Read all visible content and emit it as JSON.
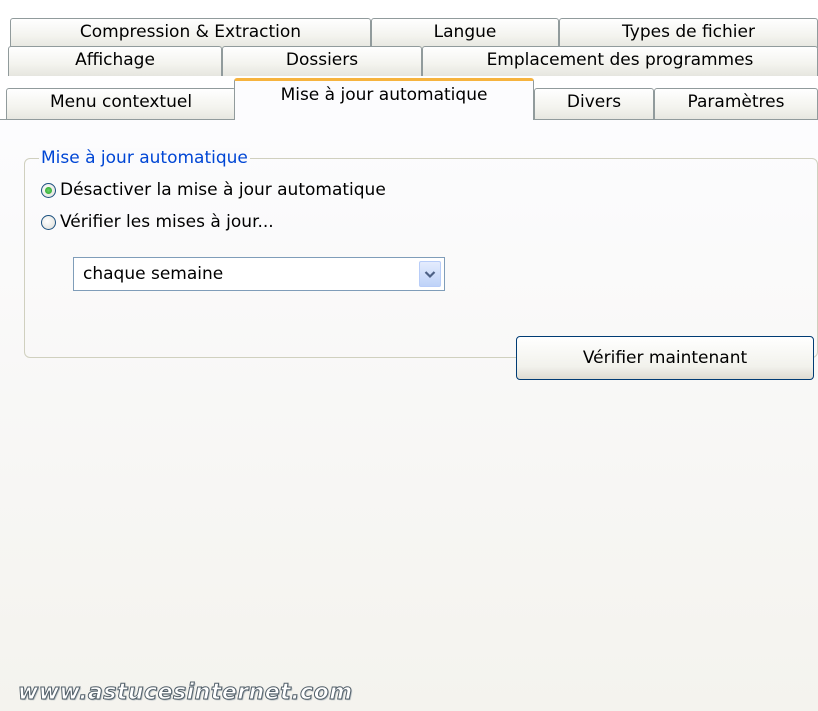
{
  "tabs": {
    "row1": [
      "Compression & Extraction",
      "Langue",
      "Types de fichier"
    ],
    "row2": [
      "Affichage",
      "Dossiers",
      "Emplacement des programmes"
    ],
    "row3": [
      "Menu contextuel",
      "Mise à jour automatique",
      "Divers",
      "Paramètres"
    ],
    "active": "Mise à jour automatique"
  },
  "update_group": {
    "legend": "Mise à jour automatique",
    "options": [
      {
        "label": "Désactiver la mise à jour automatique",
        "checked": true
      },
      {
        "label": "Vérifier les mises à jour...",
        "checked": false
      }
    ],
    "frequency": {
      "selected": "chaque semaine",
      "icon": "chevron-down-icon"
    }
  },
  "check_now_button": "Vérifier maintenant",
  "watermark": "www.astucesinternet.com",
  "colors": {
    "active_tab_accent": "#f6b33e",
    "group_legend": "#0046d5",
    "radio_checked": "#21a121"
  }
}
